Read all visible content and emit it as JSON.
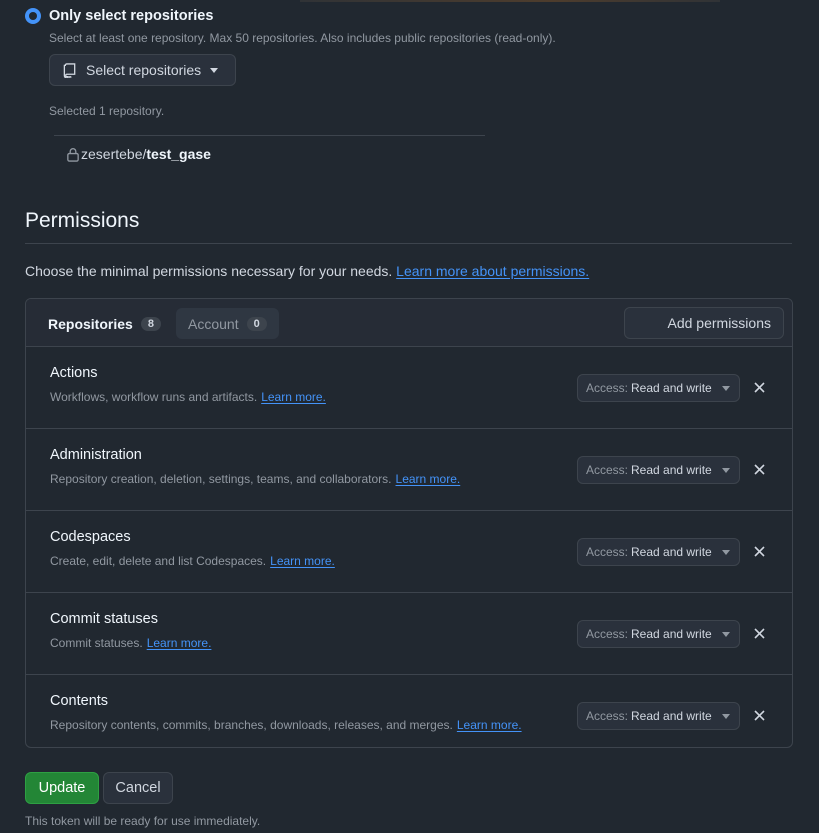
{
  "repo_access": {
    "option_label": "Only select repositories",
    "hint": "Select at least one repository. Max 50 repositories. Also includes public repositories (read-only).",
    "select_button_label": "Select repositories",
    "selected_count_text": "Selected 1 repository.",
    "selected_repo": {
      "owner": "zesertebe/",
      "name": "test_gase"
    }
  },
  "permissions": {
    "title": "Permissions",
    "description": "Choose the minimal permissions necessary for your needs.",
    "learn_more_link": "Learn more about permissions.",
    "tabs": [
      {
        "label": "Repositories",
        "count": "8"
      },
      {
        "label": "Account",
        "count": "0"
      }
    ],
    "add_button_label": "Add permissions",
    "access_key_label": "Access:",
    "learn_more_label": "Learn more.",
    "items": [
      {
        "name": "Actions",
        "description": "Workflows, workflow runs and artifacts.",
        "access": "Read and write"
      },
      {
        "name": "Administration",
        "description": "Repository creation, deletion, settings, teams, and collaborators.",
        "access": "Read and write"
      },
      {
        "name": "Codespaces",
        "description": "Create, edit, delete and list Codespaces.",
        "access": "Read and write"
      },
      {
        "name": "Commit statuses",
        "description": "Commit statuses.",
        "access": "Read and write"
      },
      {
        "name": "Contents",
        "description": "Repository contents, commits, branches, downloads, releases, and merges.",
        "access": "Read and write"
      }
    ]
  },
  "footer": {
    "update_label": "Update",
    "cancel_label": "Cancel",
    "note": "This token will be ready for use immediately."
  },
  "colors": {
    "background": "#212830",
    "accent": "#4493f8",
    "primary_button": "#238636"
  },
  "icons": [
    "radio-selected-icon",
    "repo-icon",
    "caret-down-icon",
    "lock-icon",
    "close-icon"
  ]
}
